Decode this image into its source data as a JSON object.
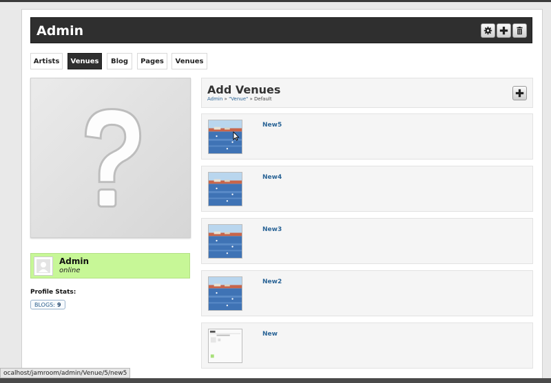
{
  "header": {
    "title": "Admin",
    "buttons": [
      {
        "icon": "gear-icon"
      },
      {
        "icon": "plus-icon"
      },
      {
        "icon": "trash-icon"
      }
    ]
  },
  "tabs": [
    {
      "label": "Artists",
      "active": false
    },
    {
      "label": "Venues",
      "active": true
    },
    {
      "label": "Blog",
      "active": false
    },
    {
      "label": "Pages",
      "active": false
    },
    {
      "label": "Venues",
      "active": false
    }
  ],
  "profile": {
    "image_icon": "question-mark-icon",
    "user_name": "Admin",
    "user_status": "online",
    "stats_title": "Profile Stats:",
    "blogs_label": "BLOGS:",
    "blogs_count": "9"
  },
  "add_section": {
    "title": "Add Venues",
    "breadcrumb": [
      {
        "label": "Admin",
        "link": true
      },
      {
        "label": "\"Venue\"",
        "link": true
      },
      {
        "label": "Default",
        "link": false
      }
    ],
    "separator": "»"
  },
  "venues": [
    {
      "title": "New5",
      "thumb": "harbor"
    },
    {
      "title": "New4",
      "thumb": "harbor"
    },
    {
      "title": "New3",
      "thumb": "harbor"
    },
    {
      "title": "New2",
      "thumb": "harbor"
    },
    {
      "title": "New",
      "thumb": "screenshot"
    }
  ],
  "status_bar": {
    "url": "ocalhost/jamroom/admin/Venue/5/new5"
  },
  "colors": {
    "header_bg": "#2f2f2f",
    "online_bg": "#c7f797",
    "link": "#2a6496"
  }
}
